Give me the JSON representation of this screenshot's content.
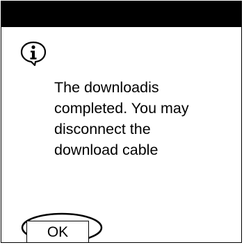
{
  "dialog": {
    "icon": "info-speech-bubble-icon",
    "message": "The downloadis\ncompleted. You may\ndisconnect the\ndownload cable",
    "ok_label": "OK"
  }
}
